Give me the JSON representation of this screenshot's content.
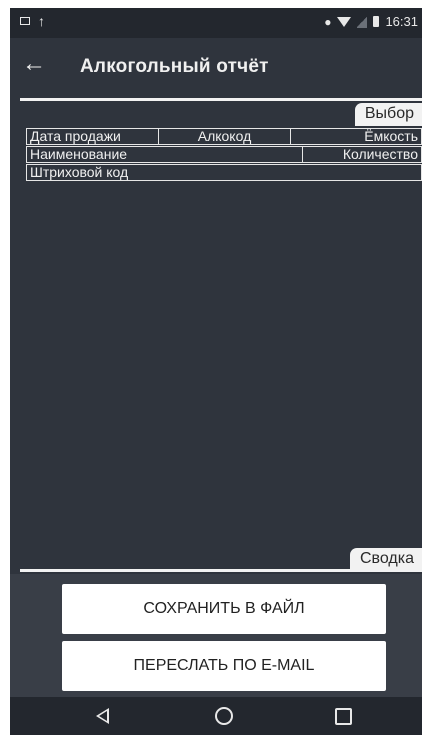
{
  "app": {
    "title": "Алкогольный отчёт",
    "time": "16:31"
  },
  "icons": {
    "back": "arrow-left-icon",
    "status": [
      "screenshot-icon",
      "upload-icon",
      "location-pin-icon",
      "wifi-icon",
      "signal-icon",
      "battery-icon"
    ],
    "nav": [
      "nav-back-icon",
      "nav-home-icon",
      "nav-recents-icon"
    ]
  },
  "tabs": {
    "select": "Выбор",
    "summary": "Сводка"
  },
  "columns": {
    "row1": [
      "Дата продажи",
      "Алкокод",
      "Ёмкость"
    ],
    "row2": [
      "Наименование",
      "Количество"
    ],
    "row3": [
      "Штриховой код"
    ]
  },
  "buttons": {
    "save": "СОХРАНИТЬ В ФАЙЛ",
    "email": "ПЕРЕСЛАТЬ ПО E-MAIL"
  },
  "colors": {
    "background": "#2f343d",
    "panel": "#393e47",
    "statusbar": "#23272e",
    "tab": "#f2f2f2"
  }
}
